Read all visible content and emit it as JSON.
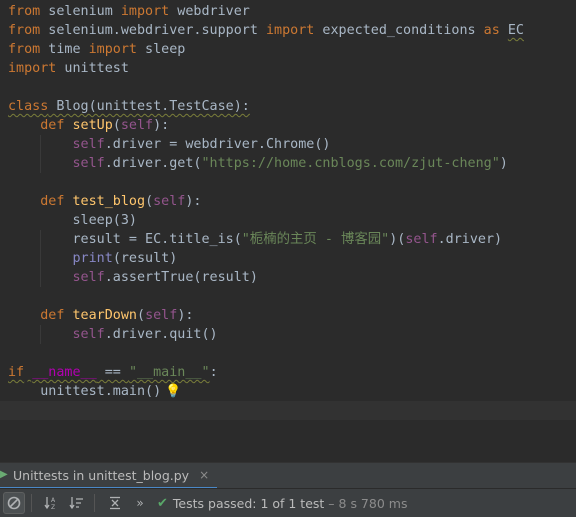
{
  "editor": {
    "lines": [
      [
        {
          "t": "from",
          "c": "kw"
        },
        {
          "t": " selenium ",
          "c": "plain"
        },
        {
          "t": "import",
          "c": "kw"
        },
        {
          "t": " webdriver",
          "c": "plain"
        }
      ],
      [
        {
          "t": "from",
          "c": "kw"
        },
        {
          "t": " selenium.webdriver.support ",
          "c": "plain"
        },
        {
          "t": "import",
          "c": "kw"
        },
        {
          "t": " expected_conditions ",
          "c": "plain"
        },
        {
          "t": "as",
          "c": "kw"
        },
        {
          "t": " ",
          "c": "plain"
        },
        {
          "t": "EC",
          "c": "plain wavy"
        }
      ],
      [
        {
          "t": "from",
          "c": "kw"
        },
        {
          "t": " time ",
          "c": "plain"
        },
        {
          "t": "import",
          "c": "kw"
        },
        {
          "t": " sleep",
          "c": "plain"
        }
      ],
      [
        {
          "t": "import",
          "c": "kw"
        },
        {
          "t": " unittest",
          "c": "plain"
        }
      ],
      [],
      [
        {
          "t": "class",
          "c": "kw wavy"
        },
        {
          "t": " Blog(unittest.TestCase):",
          "c": "plain wavy"
        }
      ],
      [
        {
          "t": "    ",
          "c": "plain"
        },
        {
          "t": "def",
          "c": "kw"
        },
        {
          "t": " ",
          "c": "plain"
        },
        {
          "t": "setUp",
          "c": "fn"
        },
        {
          "t": "(",
          "c": "plain"
        },
        {
          "t": "self",
          "c": "self"
        },
        {
          "t": "):",
          "c": "plain"
        }
      ],
      [
        {
          "t": "        ",
          "c": "plain"
        },
        {
          "t": "self",
          "c": "self"
        },
        {
          "t": ".driver = webdriver.Chrome()",
          "c": "plain"
        }
      ],
      [
        {
          "t": "        ",
          "c": "plain"
        },
        {
          "t": "self",
          "c": "self"
        },
        {
          "t": ".driver.get(",
          "c": "plain"
        },
        {
          "t": "\"https://home.cnblogs.com/zjut-cheng\"",
          "c": "str"
        },
        {
          "t": ")",
          "c": "plain"
        }
      ],
      [],
      [
        {
          "t": "    ",
          "c": "plain"
        },
        {
          "t": "def",
          "c": "kw"
        },
        {
          "t": " ",
          "c": "plain"
        },
        {
          "t": "test_blog",
          "c": "fn"
        },
        {
          "t": "(",
          "c": "plain"
        },
        {
          "t": "self",
          "c": "self"
        },
        {
          "t": "):",
          "c": "plain"
        }
      ],
      [
        {
          "t": "        sleep(3)",
          "c": "plain"
        }
      ],
      [
        {
          "t": "        result = EC.title_is(",
          "c": "plain"
        },
        {
          "t": "\"栀楠的主页 - 博客园\"",
          "c": "str"
        },
        {
          "t": ")(",
          "c": "plain"
        },
        {
          "t": "self",
          "c": "self"
        },
        {
          "t": ".driver)",
          "c": "plain"
        }
      ],
      [
        {
          "t": "        ",
          "c": "plain"
        },
        {
          "t": "print",
          "c": "builtin"
        },
        {
          "t": "(result)",
          "c": "plain"
        }
      ],
      [
        {
          "t": "        ",
          "c": "plain"
        },
        {
          "t": "self",
          "c": "self"
        },
        {
          "t": ".assertTrue(result)",
          "c": "plain"
        }
      ],
      [],
      [
        {
          "t": "    ",
          "c": "plain"
        },
        {
          "t": "def",
          "c": "kw"
        },
        {
          "t": " ",
          "c": "plain"
        },
        {
          "t": "tearDown",
          "c": "fn"
        },
        {
          "t": "(",
          "c": "plain"
        },
        {
          "t": "self",
          "c": "self"
        },
        {
          "t": "):",
          "c": "plain"
        }
      ],
      [
        {
          "t": "        ",
          "c": "plain"
        },
        {
          "t": "self",
          "c": "self"
        },
        {
          "t": ".driver.quit()",
          "c": "plain"
        }
      ],
      [],
      [
        {
          "t": "if",
          "c": "kw wavy"
        },
        {
          "t": " ",
          "c": "plain wavy"
        },
        {
          "t": "__name__",
          "c": "magic wavy"
        },
        {
          "t": " == ",
          "c": "plain wavy"
        },
        {
          "t": "\"__main__\"",
          "c": "str wavy"
        },
        {
          "t": ":",
          "c": "plain"
        }
      ],
      [
        {
          "t": "    unittest.main()",
          "c": "plain"
        }
      ],
      []
    ],
    "current_line_index": 21,
    "intention_icon": "lightbulb-icon"
  },
  "run_panel": {
    "tab_label": "Unittests in unittest_blog.py",
    "tab_close": "×",
    "status_check": "✔",
    "status_main": "Tests passed: ",
    "status_count": "1 of 1 test",
    "status_time": " – 8 s 780 ms"
  },
  "toolbar": {
    "buttons": [
      "stop-icon",
      "sort-alpha-icon",
      "sort-duration-icon",
      "collapse-all-icon",
      "more-icon"
    ]
  },
  "colors": {
    "editor_bg": "#2b2b2b",
    "keyword": "#cc7832",
    "self": "#94558d",
    "string": "#6a8759",
    "function": "#ffc66d",
    "success": "#59a869"
  }
}
